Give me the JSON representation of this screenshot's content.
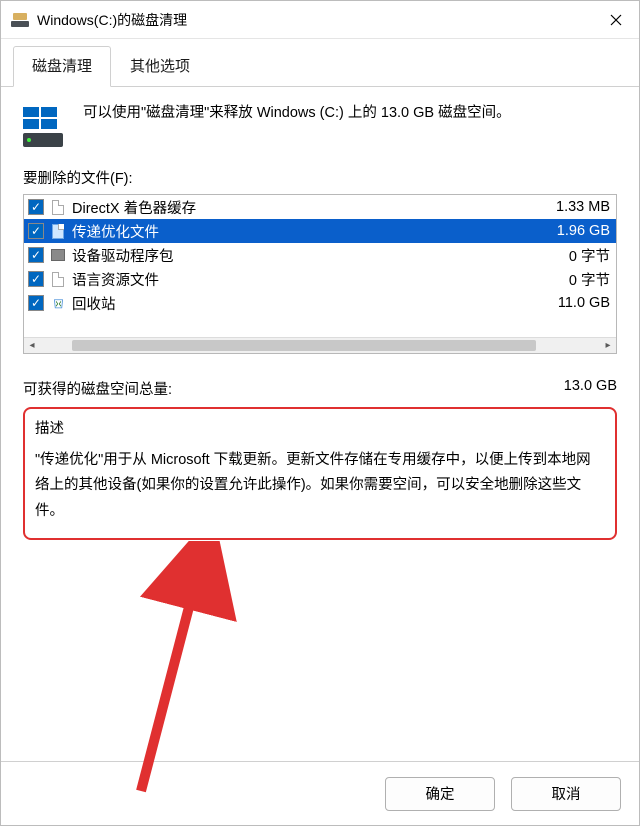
{
  "titlebar": {
    "title": "Windows(C:)的磁盘清理"
  },
  "tabs": [
    {
      "label": "磁盘清理",
      "active": true
    },
    {
      "label": "其他选项",
      "active": false
    }
  ],
  "intro": "可以使用\"磁盘清理\"来释放 Windows (C:) 上的 13.0 GB 磁盘空间。",
  "list_label": "要删除的文件(F):",
  "items": [
    {
      "checked": true,
      "icon": "page",
      "label": "DirectX 着色器缓存",
      "size": "1.33 MB",
      "selected": false
    },
    {
      "checked": true,
      "icon": "page-blue",
      "label": "传递优化文件",
      "size": "1.96 GB",
      "selected": true
    },
    {
      "checked": true,
      "icon": "pkg",
      "label": "设备驱动程序包",
      "size": "0 字节",
      "selected": false
    },
    {
      "checked": true,
      "icon": "page",
      "label": "语言资源文件",
      "size": "0 字节",
      "selected": false
    },
    {
      "checked": true,
      "icon": "bin",
      "label": "回收站",
      "size": "11.0 GB",
      "selected": false
    }
  ],
  "total": {
    "label": "可获得的磁盘空间总量:",
    "value": "13.0 GB"
  },
  "description": {
    "title": "描述",
    "text": "\"传递优化\"用于从 Microsoft 下载更新。更新文件存储在专用缓存中，以便上传到本地网络上的其他设备(如果你的设置允许此操作)。如果你需要空间，可以安全地删除这些文件。"
  },
  "footer": {
    "ok": "确定",
    "cancel": "取消"
  }
}
